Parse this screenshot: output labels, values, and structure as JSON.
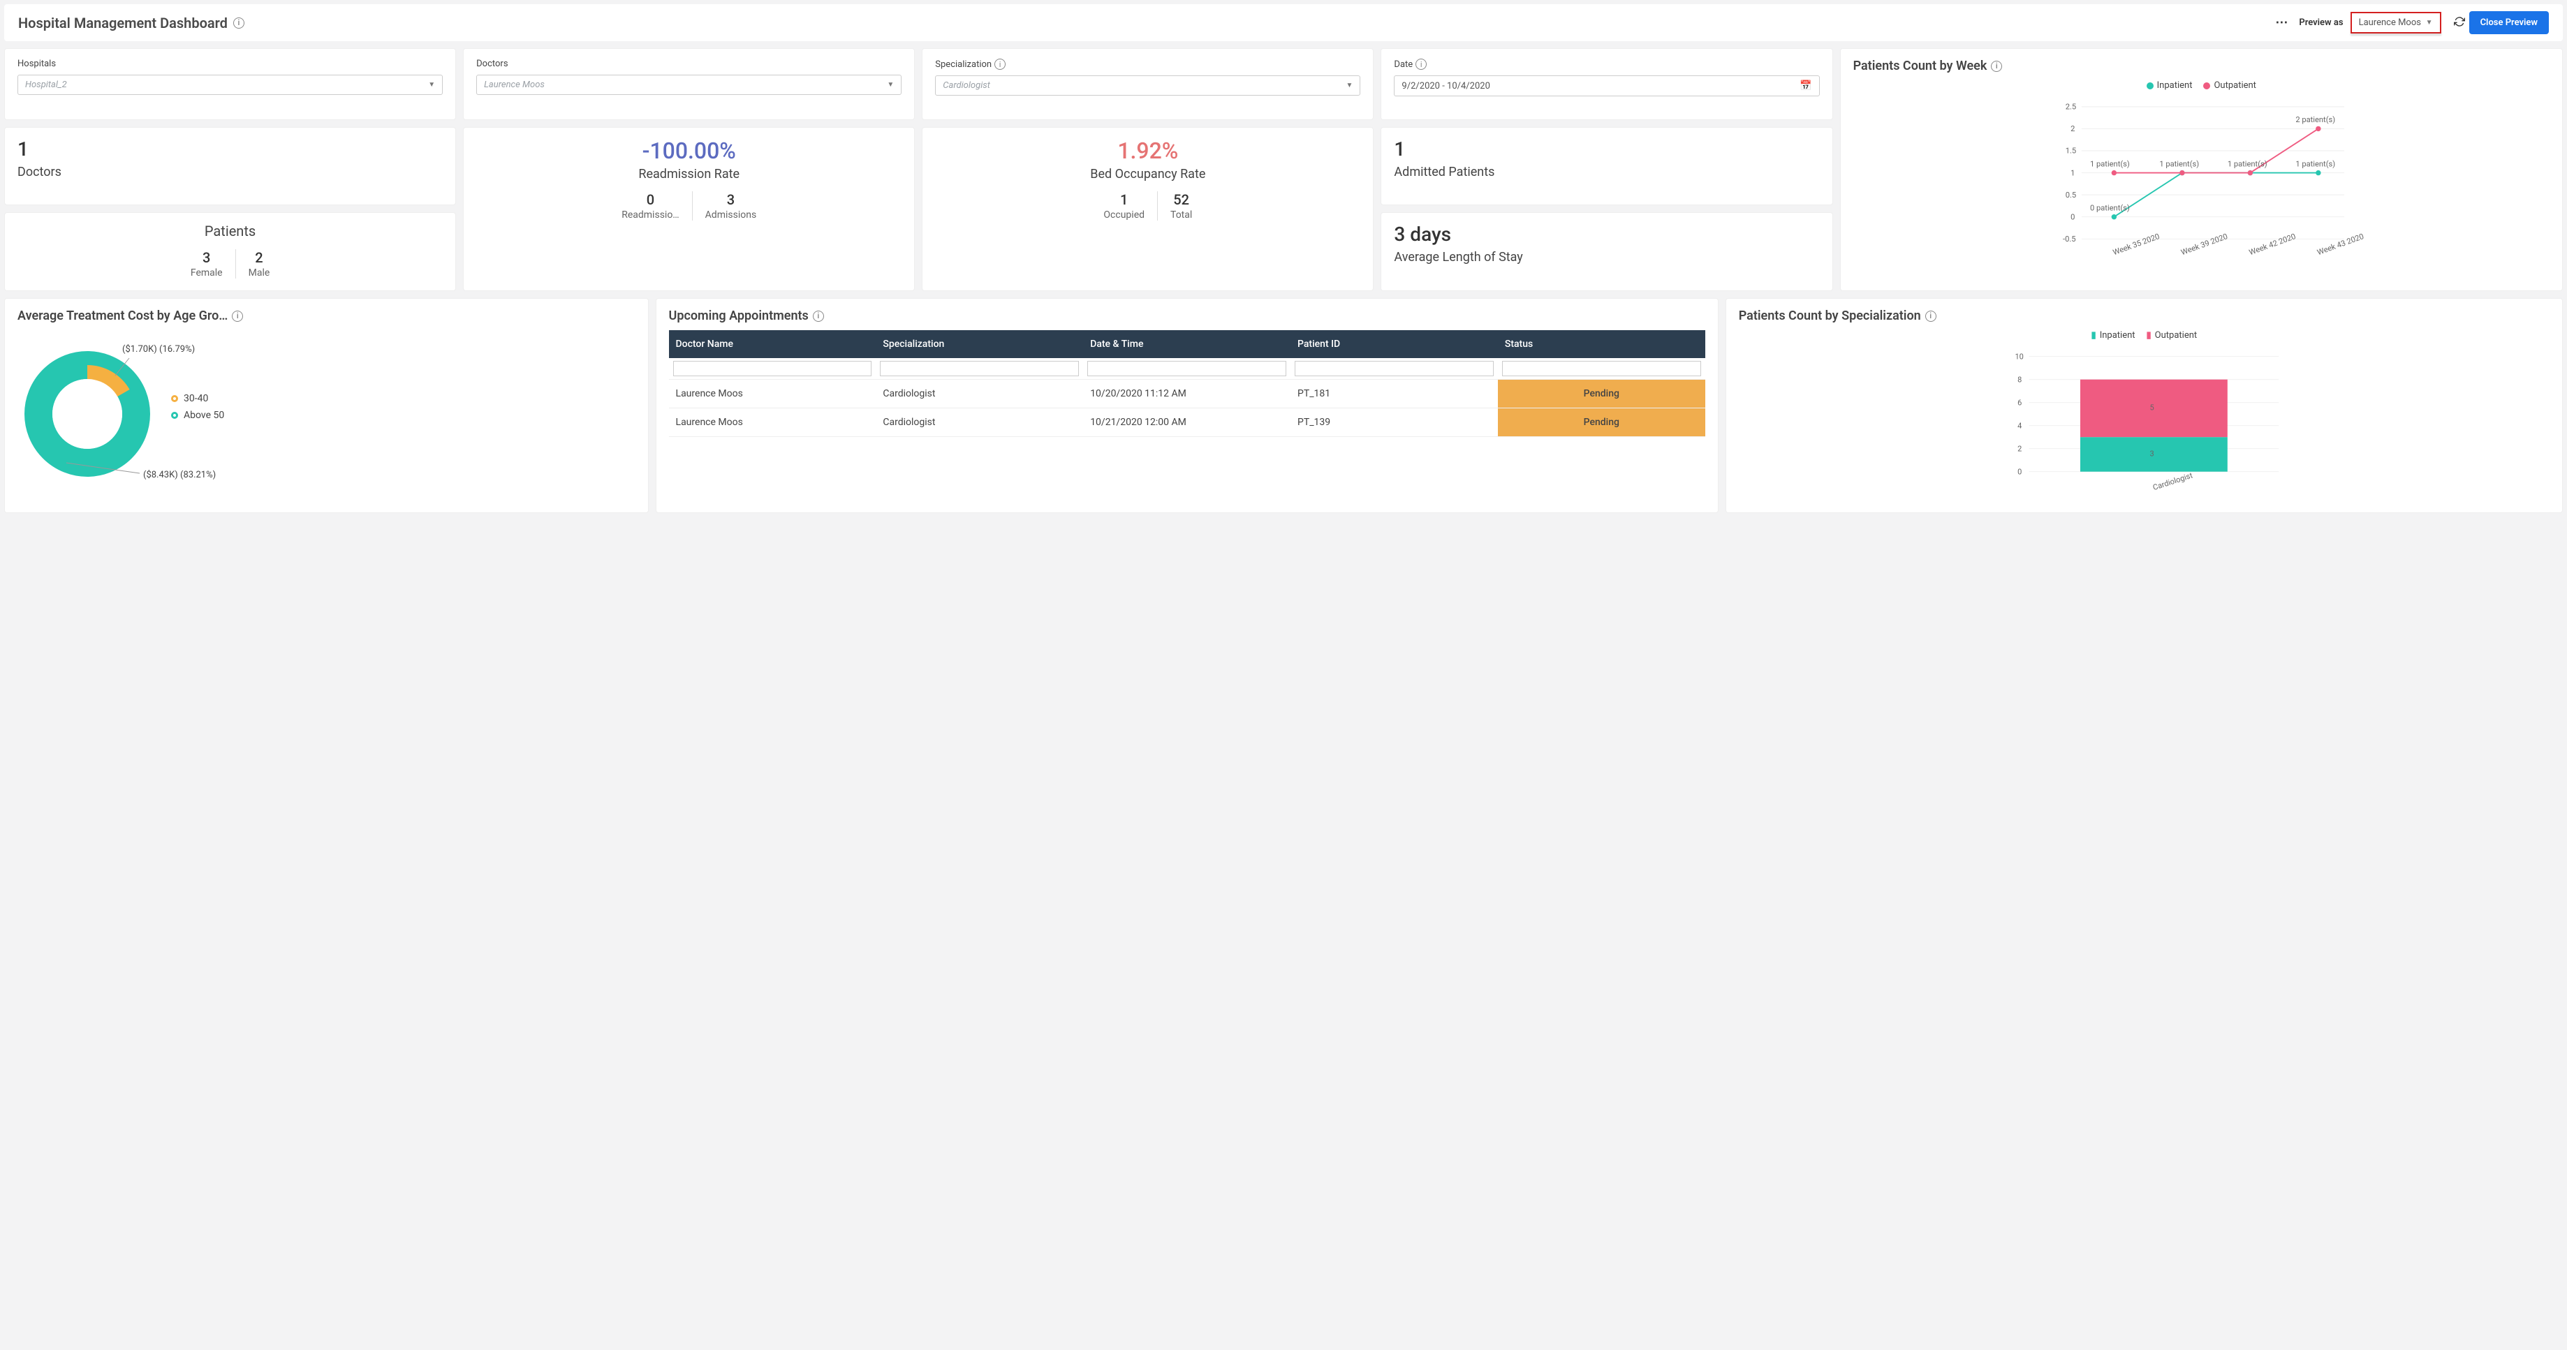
{
  "header": {
    "title": "Hospital Management Dashboard",
    "preview_as_label": "Preview as",
    "preview_user": "Laurence Moos",
    "close_button": "Close Preview"
  },
  "filters": {
    "hospitals": {
      "label": "Hospitals",
      "value": "Hospital_2"
    },
    "doctors": {
      "label": "Doctors",
      "value": "Laurence Moos"
    },
    "specialization": {
      "label": "Specialization",
      "value": "Cardiologist"
    },
    "date": {
      "label": "Date",
      "value": "9/2/2020 - 10/4/2020"
    }
  },
  "kpis": {
    "doctors": {
      "value": "1",
      "label": "Doctors"
    },
    "readmission": {
      "value": "-100.00%",
      "label": "Readmission Rate",
      "sub1_val": "0",
      "sub1_lbl": "Readmissio…",
      "sub2_val": "3",
      "sub2_lbl": "Admissions"
    },
    "bed_occ": {
      "value": "1.92%",
      "label": "Bed Occupancy Rate",
      "sub1_val": "1",
      "sub1_lbl": "Occupied",
      "sub2_val": "52",
      "sub2_lbl": "Total"
    },
    "admitted": {
      "value": "1",
      "label": "Admitted Patients"
    },
    "alos": {
      "value": "3 days",
      "label": "Average Length of Stay"
    },
    "patients": {
      "label": "Patients",
      "sub1_val": "3",
      "sub1_lbl": "Female",
      "sub2_val": "2",
      "sub2_lbl": "Male"
    }
  },
  "charts": {
    "week": {
      "title": "Patients Count by Week",
      "legend": {
        "inpatient": "Inpatient",
        "outpatient": "Outpatient"
      }
    },
    "cost": {
      "title": "Average Treatment Cost by Age Gro…",
      "legend": {
        "a": "30-40",
        "b": "Above 50"
      },
      "label_a": "($1.70K) (16.79%)",
      "label_b": "($8.43K) (83.21%)"
    },
    "spec": {
      "title": "Patients Count by Specialization",
      "legend": {
        "inpatient": "Inpatient",
        "outpatient": "Outpatient"
      }
    }
  },
  "appointments": {
    "title": "Upcoming Appointments",
    "headers": {
      "doctor": "Doctor Name",
      "spec": "Specialization",
      "dt": "Date & Time",
      "pid": "Patient ID",
      "status": "Status"
    },
    "rows": [
      {
        "doctor": "Laurence Moos",
        "spec": "Cardiologist",
        "dt": "10/20/2020 11:12 AM",
        "pid": "PT_181",
        "status": "Pending"
      },
      {
        "doctor": "Laurence Moos",
        "spec": "Cardiologist",
        "dt": "10/21/2020 12:00 AM",
        "pid": "PT_139",
        "status": "Pending"
      }
    ]
  },
  "chart_data": [
    {
      "type": "line",
      "title": "Patients Count by Week",
      "categories": [
        "Week 35 2020",
        "Week 39 2020",
        "Week 42 2020",
        "Week 43 2020"
      ],
      "series": [
        {
          "name": "Inpatient",
          "values": [
            0,
            1,
            1,
            1
          ],
          "color": "#26c6b0"
        },
        {
          "name": "Outpatient",
          "values": [
            1,
            1,
            1,
            2
          ],
          "color": "#ef5b81"
        }
      ],
      "point_labels": [
        "0 patient(s)",
        "1 patient(s)",
        "1 patient(s)",
        "1 patient(s)",
        "2 patient(s)"
      ],
      "ylim": [
        -0.5,
        2.5
      ],
      "yticks": [
        -0.5,
        0,
        0.5,
        1,
        1.5,
        2,
        2.5
      ]
    },
    {
      "type": "pie",
      "title": "Average Treatment Cost by Age Group",
      "series": [
        {
          "name": "30-40",
          "value_label": "$1.70K",
          "percent": 16.79,
          "color": "#f5b041"
        },
        {
          "name": "Above 50",
          "value_label": "$8.43K",
          "percent": 83.21,
          "color": "#26c6b0"
        }
      ]
    },
    {
      "type": "bar",
      "title": "Patients Count by Specialization",
      "categories": [
        "Cardiologist"
      ],
      "series": [
        {
          "name": "Inpatient",
          "values": [
            3
          ],
          "color": "#26c6b0"
        },
        {
          "name": "Outpatient",
          "values": [
            5
          ],
          "color": "#ef5b81"
        }
      ],
      "stacked": true,
      "ylim": [
        0,
        10
      ],
      "yticks": [
        0,
        2,
        4,
        6,
        8,
        10
      ]
    }
  ]
}
